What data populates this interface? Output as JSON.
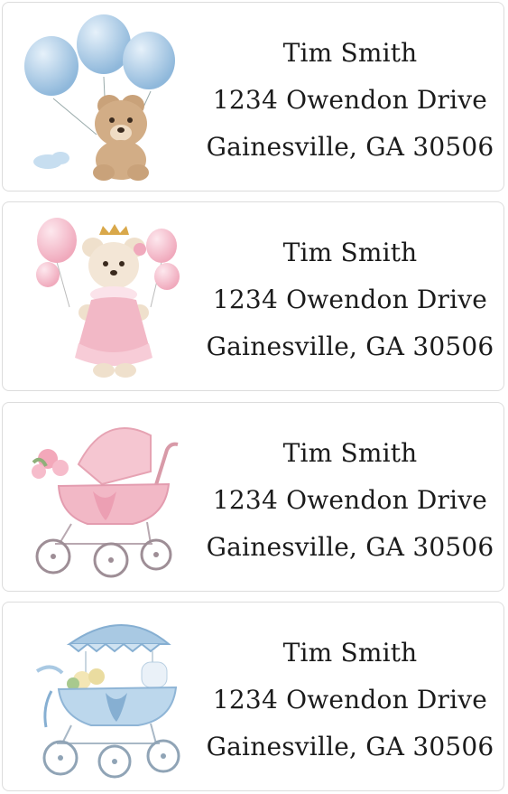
{
  "labels": [
    {
      "name": "Tim Smith",
      "street": "1234 Owendon Drive",
      "city": "Gainesville, GA 30506",
      "art_icon": "teddy-bear-blue-balloons-icon"
    },
    {
      "name": "Tim Smith",
      "street": "1234 Owendon Drive",
      "city": "Gainesville, GA 30506",
      "art_icon": "teddy-bear-princess-pink-icon"
    },
    {
      "name": "Tim Smith",
      "street": "1234 Owendon Drive",
      "city": "Gainesville, GA 30506",
      "art_icon": "pink-baby-carriage-icon"
    },
    {
      "name": "Tim Smith",
      "street": "1234 Owendon Drive",
      "city": "Gainesville, GA 30506",
      "art_icon": "blue-baby-carriage-icon"
    }
  ],
  "colors": {
    "blue": "#a9c9e3",
    "pink": "#f2b8c6",
    "bear": "#c9a27a",
    "text": "#1b1b1b"
  }
}
